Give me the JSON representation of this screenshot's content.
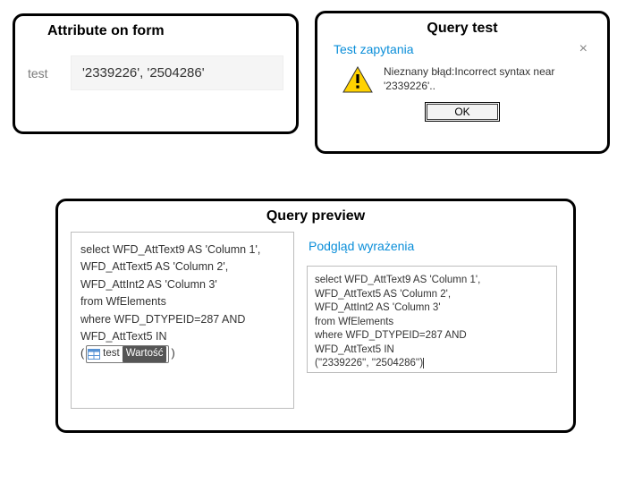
{
  "attr_panel": {
    "title": "Attribute on form",
    "label": "test",
    "value": "'2339226', '2504286'"
  },
  "qtest_panel": {
    "title": "Query test",
    "dialog_title": "Test zapytania",
    "close_glyph": "×",
    "message": "Nieznany błąd:Incorrect syntax near '2339226'..",
    "ok_label": "OK"
  },
  "qprev_panel": {
    "title": "Query preview",
    "left_lines": [
      "select WFD_AttText9 AS 'Column 1',",
      "WFD_AttText5 AS 'Column 2',",
      "WFD_AttInt2 AS 'Column 3'",
      "from WfElements",
      "where WFD_DTYPEID=287 AND",
      "WFD_AttText5 IN"
    ],
    "chip": {
      "label": "test",
      "value": "Wartość"
    },
    "right_subhead": "Podgląd wyrażenia",
    "right_code": "select WFD_AttText9 AS 'Column 1',\nWFD_AttText5 AS 'Column 2',\nWFD_AttInt2 AS 'Column 3'\nfrom WfElements\nwhere WFD_DTYPEID=287 AND\nWFD_AttText5 IN\n(''2339226'', ''2504286'')"
  }
}
